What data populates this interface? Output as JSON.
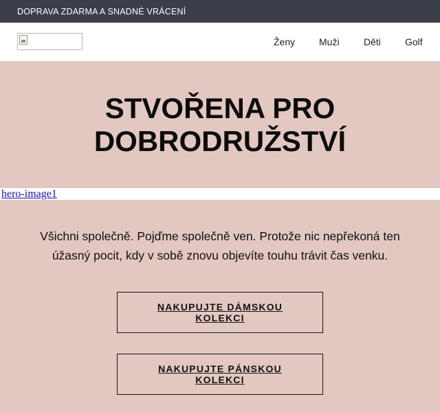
{
  "promo": {
    "text": "DOPRAVA ZDARMA A SNADNÉ VRÁCENÍ"
  },
  "header": {
    "nav": [
      {
        "label": "Ženy"
      },
      {
        "label": "Muži"
      },
      {
        "label": "Děti"
      },
      {
        "label": "Golf"
      }
    ]
  },
  "hero": {
    "title_line1": "STVOŘENA PRO",
    "title_line2": "DOBRODRUŽSTVÍ",
    "image_alt": "hero-image1"
  },
  "intro": {
    "text": "Všichni společně. Pojďme společně ven. Protože nic nepřekoná ten úžasný pocit, kdy v sobě znovu objevíte touhu trávit čas venku."
  },
  "cta": {
    "women_label": "NAKUPUJTE DÁMSKOU KOLEKCI",
    "men_label": "NAKUPUJTE PÁNSKOU KOLEKCI"
  },
  "colors": {
    "promo_bg": "#3a3f4b",
    "page_bg": "#e3c8c2",
    "header_bg": "#ffffff",
    "link": "#1a0dab"
  }
}
